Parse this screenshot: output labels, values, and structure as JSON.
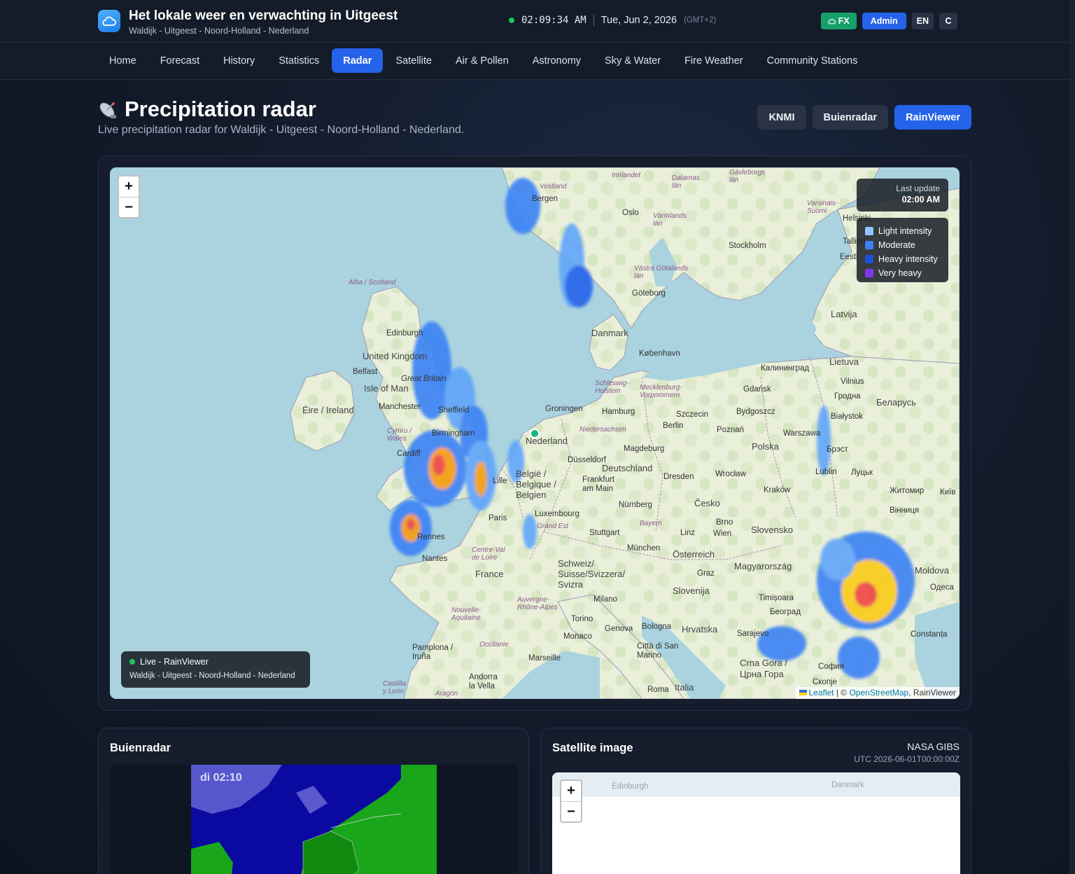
{
  "header": {
    "title": "Het lokale weer en verwachting in Uitgeest",
    "subtitle": "Waldijk - Uitgeest - Noord-Holland - Nederland",
    "time": "02:09:34 AM",
    "date": "Tue, Jun 2, 2026",
    "timezone": "(GMT+2)",
    "fx_label": "FX",
    "admin_label": "Admin",
    "lang_label": "EN",
    "unit_label": "C",
    "colors": {
      "fx": "#16a06a",
      "admin": "#2563eb",
      "live": "#22c55e"
    }
  },
  "nav": {
    "items": [
      {
        "label": "Home"
      },
      {
        "label": "Forecast"
      },
      {
        "label": "History"
      },
      {
        "label": "Statistics"
      },
      {
        "label": "Radar",
        "active": true
      },
      {
        "label": "Satellite"
      },
      {
        "label": "Air & Pollen"
      },
      {
        "label": "Astronomy"
      },
      {
        "label": "Sky & Water"
      },
      {
        "label": "Fire Weather"
      },
      {
        "label": "Community Stations"
      }
    ]
  },
  "page": {
    "icon": "satellite-dish-icon",
    "title": "Precipitation radar",
    "subtitle": "Live precipitation radar for Waldijk - Uitgeest - Noord-Holland - Nederland.",
    "sources": [
      {
        "label": "KNMI"
      },
      {
        "label": "Buienradar"
      },
      {
        "label": "RainViewer",
        "active": true
      }
    ]
  },
  "map": {
    "zoom_in": "+",
    "zoom_out": "−",
    "last_update_label": "Last update",
    "last_update_time": "02:00 AM",
    "legend": [
      {
        "label": "Light intensity",
        "color": "#93c5fd"
      },
      {
        "label": "Moderate",
        "color": "#3b82f6"
      },
      {
        "label": "Heavy intensity",
        "color": "#1d4ed8"
      },
      {
        "label": "Very heavy",
        "color": "#7c3aed"
      }
    ],
    "live_label": "Live - RainViewer",
    "live_location": "Waldijk - Uitgeest - Noord-Holland - Nederland",
    "attribution": {
      "leaflet": "Leaflet",
      "sep": " | © ",
      "osm": "OpenStreetMap",
      "tail": ", RainViewer"
    },
    "labels": {
      "bergen": "Bergen",
      "oslo": "Oslo",
      "stockholm": "Stockholm",
      "helsinki": "Helsinki",
      "goteborg": "Göteborg",
      "danmark": "Danmark",
      "kobenhavn": "København",
      "latvija": "Latvija",
      "lietuva": "Lietuva",
      "vilnius": "Vilnius",
      "edinburgh": "Edinburgh",
      "uk": "United Kingdom",
      "belfast": "Belfast",
      "isleofman": "Isle of Man",
      "greatbritain": "Great Britain",
      "eire": "Éire / Ireland",
      "manchester": "Manchester",
      "sheffield": "Sheffield",
      "birmingham": "Birmingham",
      "cardiff": "Cardiff",
      "groningen": "Groningen",
      "nederland": "Nederland",
      "hamburg": "Hamburg",
      "szczecin": "Szczecin",
      "gdansk": "Gdańsk",
      "kaliningrad": "Калининград",
      "bydgoszcz": "Bydgoszcz",
      "berlin": "Berlin",
      "poznan": "Poznań",
      "warszawa": "Warszawa",
      "polska": "Polska",
      "bialystok": "Białystok",
      "grodno": "Гродна",
      "belarus": "Беларусь",
      "dusseldorf": "Düsseldorf",
      "deutschland": "Deutschland",
      "magdeburg": "Magdeburg",
      "dresden": "Dresden",
      "wroclaw": "Wrocław",
      "krakow": "Kraków",
      "frankfurt": "Frankfurt am Main",
      "belgique": "België / Belgique / Belgien",
      "lille": "Lille",
      "paris": "Paris",
      "luxembourg": "Luxembourg",
      "nurnberg": "Nürnberg",
      "cesko": "Česko",
      "brno": "Brno",
      "wien": "Wien",
      "slovensko": "Slovensko",
      "lublin": "Lublin",
      "lutsk": "Луцьк",
      "brest": "Брэст",
      "zhytomyr": "Житомир",
      "kyiv": "Київ",
      "vinnytsia": "Вінниця",
      "stuttgart": "Stuttgart",
      "munchen": "München",
      "linz": "Linz",
      "osterreich": "Österreich",
      "graz": "Graz",
      "magyarorszag": "Magyarország",
      "france": "France",
      "nantes": "Nantes",
      "rennes": "Rennes",
      "schweiz": "Schweiz/ Suisse/Svizzera/ Svizra",
      "milano": "Milano",
      "torino": "Torino",
      "genova": "Genova",
      "bologna": "Bologna",
      "slovenija": "Slovenija",
      "hrvatska": "Hrvatska",
      "monaco": "Monaco",
      "sanmarino": "Città di San Marino",
      "marseille": "Marseille",
      "andorra": "Andorra la Vella",
      "pamplona": "Pamplona / Iruña",
      "roma": "Roma",
      "italia": "Italia",
      "timisoara": "Timișoara",
      "beograd": "Београд",
      "sarajevo": "Sarajevo",
      "crnagora": "Crna Gora / Црна Гора",
      "sofia": "София",
      "skopje": "Скопје",
      "constanta": "Constanța",
      "moldova": "Moldova",
      "odesa": "Одеса",
      "alba": "Alba / Scotland",
      "cymru": "Cymru / Wales",
      "niedersachsen": "Niedersachsen",
      "bayern": "Bayern",
      "grandest": "Grand Est",
      "centre": "Centre-Val de Loire",
      "aquitaine": "Nouvelle-Aquitaine",
      "auvergne": "Auvergne-Rhône-Alpes",
      "occitanie": "Occitanie",
      "castilla": "Castilla y León",
      "aragon": "Aragón",
      "schleswig": "Schleswig-Holstein",
      "mecklenburg": "Mecklenburg-Vorpommern",
      "vastra": "Västra Götalands län",
      "varmlands": "Värmlands län",
      "dalarnas": "Dalarnas län",
      "gavleborgs": "Gävleborgs län",
      "innlandet": "Innlandet",
      "vestland": "Vestland",
      "varsinais": "Varsinais-Suomi",
      "tallinn": "Tallinn",
      "eesti": "Eesti"
    }
  },
  "buienradar": {
    "title": "Buienradar",
    "timestamp": "di 02:10"
  },
  "satellite": {
    "title": "Satellite image",
    "source": "NASA GIBS",
    "utc": "UTC 2026-06-01T00:00:00Z",
    "labels": {
      "edinburgh": "Edinburgh",
      "danmark": "Danmark"
    }
  }
}
